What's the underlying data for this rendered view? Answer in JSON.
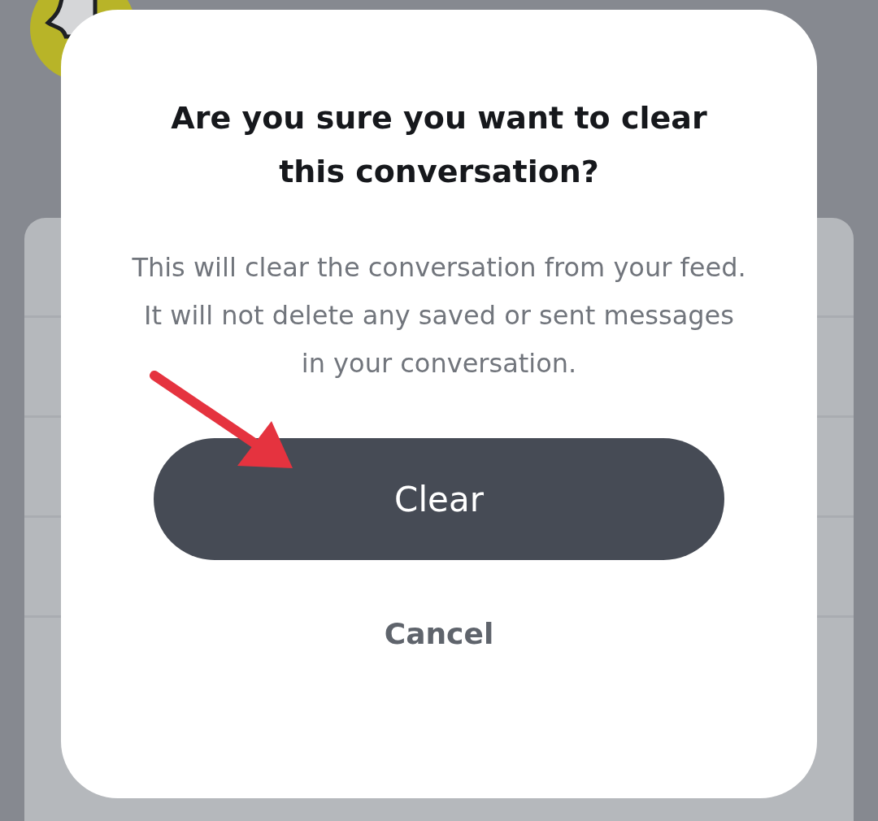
{
  "dialog": {
    "title": "Are you sure you want to clear this conversation?",
    "message": "This will clear the conversation from your feed. It will not delete any saved or sent messages in your conversation.",
    "buttons": [
      {
        "label": "Clear",
        "kind": "primary"
      },
      {
        "label": "Cancel",
        "kind": "secondary"
      }
    ]
  }
}
